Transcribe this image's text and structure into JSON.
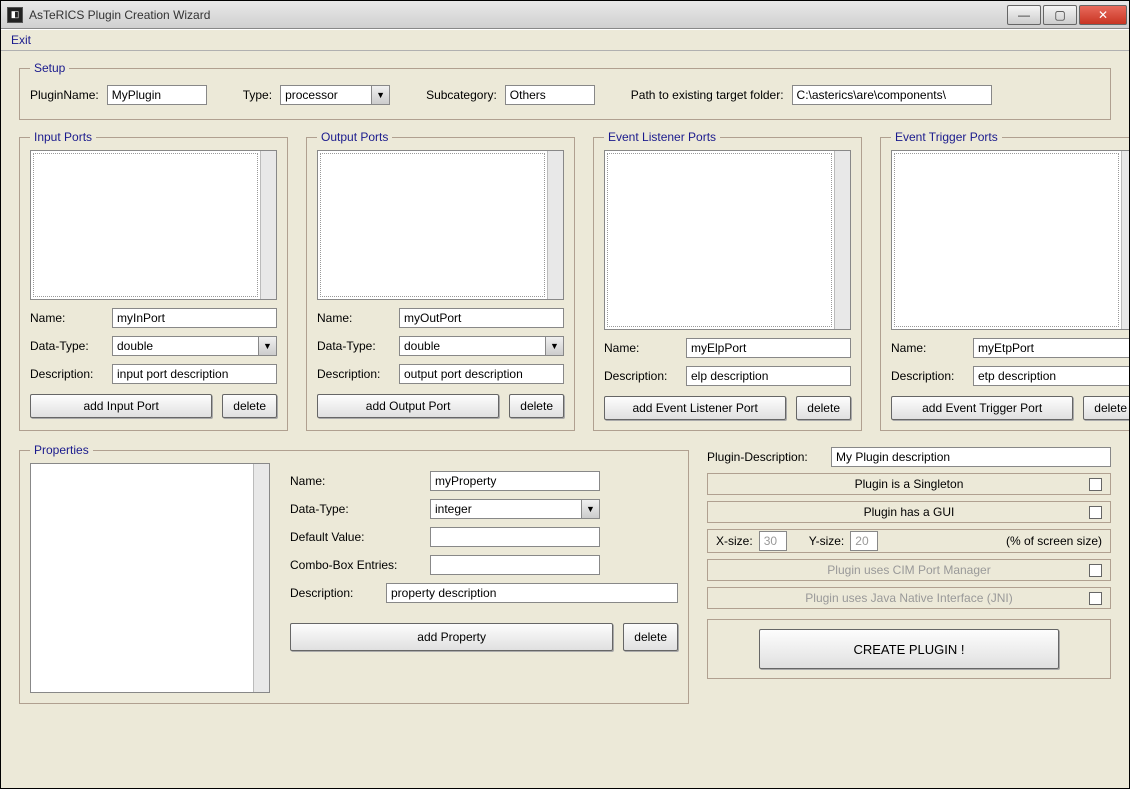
{
  "window": {
    "title": "AsTeRICS Plugin Creation Wizard",
    "menu_exit": "Exit"
  },
  "setup": {
    "legend": "Setup",
    "pluginname_label": "PluginName:",
    "pluginname_value": "MyPlugin",
    "type_label": "Type:",
    "type_value": "processor",
    "subcategory_label": "Subcategory:",
    "subcategory_value": "Others",
    "path_label": "Path to existing target folder:",
    "path_value": "C:\\asterics\\are\\components\\"
  },
  "input_ports": {
    "legend": "Input Ports",
    "name_label": "Name:",
    "name_value": "myInPort",
    "datatype_label": "Data-Type:",
    "datatype_value": "double",
    "desc_label": "Description:",
    "desc_value": "input port description",
    "add_btn": "add Input Port",
    "delete_btn": "delete"
  },
  "output_ports": {
    "legend": "Output Ports",
    "name_label": "Name:",
    "name_value": "myOutPort",
    "datatype_label": "Data-Type:",
    "datatype_value": "double",
    "desc_label": "Description:",
    "desc_value": "output port description",
    "add_btn": "add Output Port",
    "delete_btn": "delete"
  },
  "event_listener_ports": {
    "legend": "Event Listener Ports",
    "name_label": "Name:",
    "name_value": "myElpPort",
    "desc_label": "Description:",
    "desc_value": "elp description",
    "add_btn": "add Event Listener Port",
    "delete_btn": "delete"
  },
  "event_trigger_ports": {
    "legend": "Event Trigger Ports",
    "name_label": "Name:",
    "name_value": "myEtpPort",
    "desc_label": "Description:",
    "desc_value": "etp description",
    "add_btn": "add Event Trigger Port",
    "delete_btn": "delete"
  },
  "properties": {
    "legend": "Properties",
    "name_label": "Name:",
    "name_value": "myProperty",
    "datatype_label": "Data-Type:",
    "datatype_value": "integer",
    "default_label": "Default Value:",
    "default_value": "",
    "combo_label": "Combo-Box Entries:",
    "combo_value": "",
    "desc_label": "Description:",
    "desc_value": "property description",
    "add_btn": "add Property",
    "delete_btn": "delete"
  },
  "plugin_options": {
    "desc_label": "Plugin-Description:",
    "desc_value": "My Plugin description",
    "singleton_label": "Plugin is a Singleton",
    "gui_label": "Plugin has a GUI",
    "xsize_label": "X-size:",
    "xsize_value": "30",
    "ysize_label": "Y-size:",
    "ysize_value": "20",
    "pct_label": "(% of screen size)",
    "cim_label": "Plugin uses CIM Port Manager",
    "jni_label": "Plugin uses Java Native Interface (JNI)",
    "create_btn": "CREATE PLUGIN !"
  }
}
